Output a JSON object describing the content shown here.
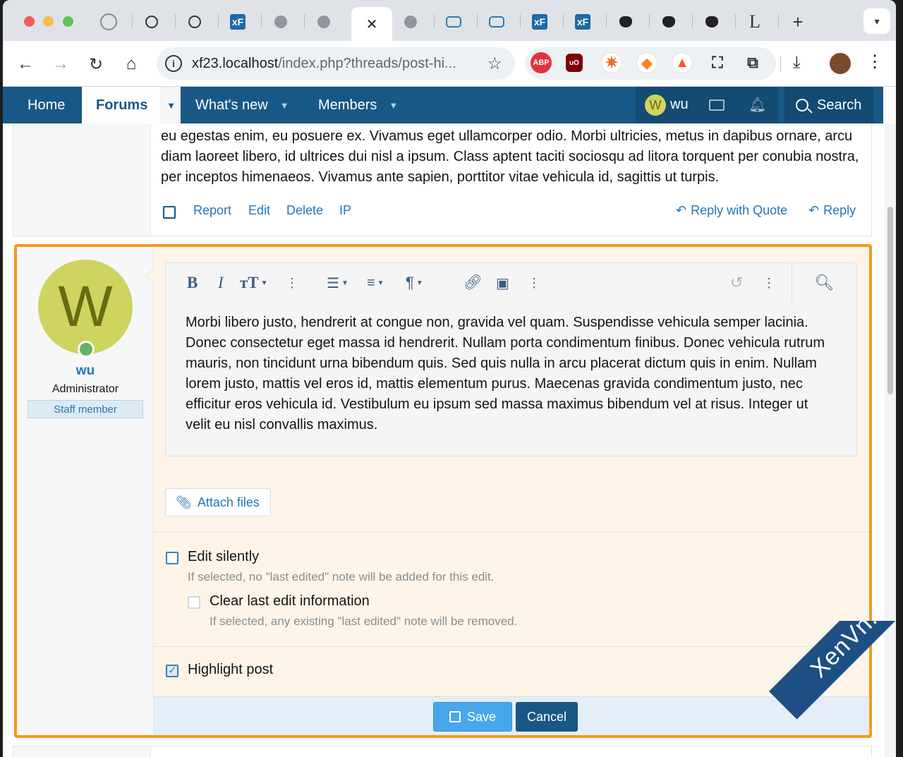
{
  "browser": {
    "url_host": "xf23.localhost",
    "url_path": "/index.php?threads/post-hi...",
    "tabs": [
      {
        "icon": "site-logo-icon"
      },
      {
        "icon": "openai-icon"
      },
      {
        "icon": "openai-icon"
      },
      {
        "icon": "xenforo-icon",
        "label": "xF"
      },
      {
        "icon": "globe-icon"
      },
      {
        "icon": "globe-icon"
      },
      {
        "icon": "close-icon",
        "active": true
      },
      {
        "icon": "globe-icon"
      },
      {
        "icon": "chat-icon"
      },
      {
        "icon": "chat-icon"
      },
      {
        "icon": "xenforo-icon",
        "label": "xF"
      },
      {
        "icon": "xenforo-icon",
        "label": "xF"
      },
      {
        "icon": "wolf-icon"
      },
      {
        "icon": "wolf-icon"
      },
      {
        "icon": "wolf-icon"
      },
      {
        "icon": "letter-icon",
        "label": "L"
      }
    ],
    "new_tab": "+",
    "extensions": {
      "abp": "ABP",
      "ublock": "uO"
    }
  },
  "nav": {
    "home": "Home",
    "forums": "Forums",
    "whats_new": "What's new",
    "members": "Members",
    "user_initial": "W",
    "username": "wu",
    "search": "Search"
  },
  "prev_post": {
    "text": "eu egestas enim, eu posuere ex. Vivamus eget ullamcorper odio. Morbi ultricies, metus in dapibus ornare, arcu diam laoreet libero, id ultrices dui nisl a ipsum. Class aptent taciti sociosqu ad litora torquent per conubia nostra, per inceptos himenaeos. Vivamus ante sapien, porttitor vitae vehicula id, sagittis ut turpis.",
    "actions": {
      "report": "Report",
      "edit": "Edit",
      "delete": "Delete",
      "ip": "IP",
      "reply_quote": "Reply with Quote",
      "reply": "Reply"
    }
  },
  "edit_post": {
    "avatar_initial": "W",
    "username": "wu",
    "role": "Administrator",
    "badge": "Staff member",
    "editor_text": "Morbi libero justo, hendrerit at congue non, gravida vel quam. Suspendisse vehicula semper lacinia. Donec consectetur eget massa id hendrerit. Nullam porta condimentum finibus. Donec vehicula rutrum mauris, non tincidunt urna bibendum quis. Sed quis nulla in arcu placerat dictum quis in enim. Nullam lorem justo, mattis vel eros id, mattis elementum purus. Maecenas gravida condimentum justo, nec efficitur eros vehicula id. Vestibulum eu ipsum sed massa maximus bibendum vel at risus. Integer ut velit eu nisl convallis maximus.",
    "toolbar": {
      "bold": "B",
      "italic": "I",
      "size": "тT"
    },
    "attach": "Attach files",
    "edit_silently": {
      "label": "Edit silently",
      "hint": "If selected, no \"last edited\" note will be added for this edit.",
      "checked": false
    },
    "clear_edit": {
      "label": "Clear last edit information",
      "hint": "If selected, any existing \"last edited\" note will be removed.",
      "checked": false
    },
    "highlight": {
      "label": "Highlight post",
      "checked": true
    },
    "save": "Save",
    "cancel": "Cancel"
  },
  "watermark": "XenVn.Com",
  "colors": {
    "nav_bg": "#185886",
    "accent_link": "#2577b1",
    "edit_border": "#f29a1f",
    "edit_bg": "#fef5e8",
    "save_btn": "#47a7eb",
    "avatar_bg": "#ced45e"
  }
}
